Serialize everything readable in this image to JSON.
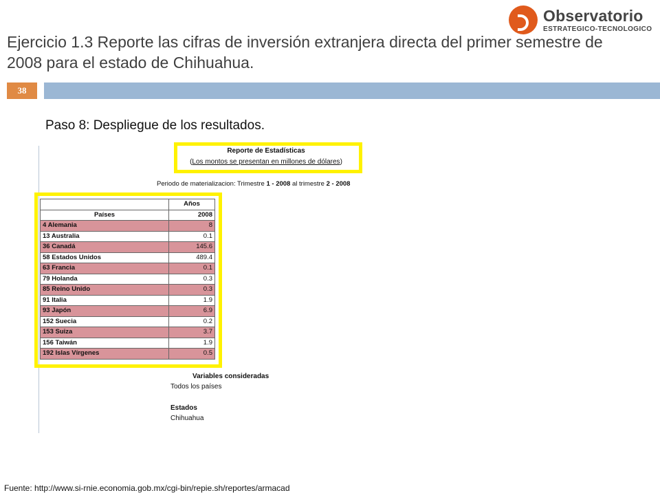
{
  "slide": {
    "title": "Ejercicio 1.3 Reporte las cifras de inversión extranjera directa del primer semestre de 2008 para el estado de Chihuahua.",
    "number": "38",
    "step": "Paso 8: Despliegue de los resultados.",
    "source": "Fuente: http://www.si-rnie.economia.gob.mx/cgi-bin/repie.sh/reportes/armacad"
  },
  "logo": {
    "name": "Observatorio",
    "subtitle": "ESTRATEGICO-TECNOLOGICO"
  },
  "report": {
    "title": "Reporte de Estadísticas",
    "subtitle_open": "(",
    "subtitle_text": "Los montos se presentan en millones de dólares",
    "subtitle_close": ")",
    "period_prefix": "Periodo de materializacion: Trimestre ",
    "period_q1": "1 - 2008",
    "period_mid": " al trimestre ",
    "period_q2": "2 - 2008",
    "table": {
      "header_years": "Años",
      "header_countries": "Países",
      "header_year": "2008",
      "rows": [
        {
          "country": "4 Alemania",
          "value": "8",
          "style": "pink"
        },
        {
          "country": "13 Australia",
          "value": "0.1",
          "style": "white"
        },
        {
          "country": "36 Canadá",
          "value": "145.6",
          "style": "pink"
        },
        {
          "country": "58 Estados Unidos",
          "value": "489.4",
          "style": "white"
        },
        {
          "country": "63 Francia",
          "value": "0.1",
          "style": "pink"
        },
        {
          "country": "79 Holanda",
          "value": "0.3",
          "style": "white"
        },
        {
          "country": "85 Reino Unido",
          "value": "0.3",
          "style": "pink"
        },
        {
          "country": "91 Italia",
          "value": "1.9",
          "style": "white"
        },
        {
          "country": "93 Japón",
          "value": "6.9",
          "style": "pink"
        },
        {
          "country": "152 Suecia",
          "value": "0.2",
          "style": "white"
        },
        {
          "country": "153 Suiza",
          "value": "3.7",
          "style": "pink"
        },
        {
          "country": "156 Taiwán",
          "value": "1.9",
          "style": "white"
        },
        {
          "country": "192 Islas Vírgenes",
          "value": "0.5",
          "style": "pink"
        }
      ]
    },
    "variables_title": "Variables consideradas",
    "variables_text": "Todos los países",
    "states_title": "Estados",
    "states_text": "Chihuahua"
  },
  "colors": {
    "accent_band": "#9bb7d4",
    "slide_number_bg": "#e08a44",
    "highlight": "#fff200",
    "row_pink": "#d8949a",
    "logo_orange": "#e05a1c"
  }
}
